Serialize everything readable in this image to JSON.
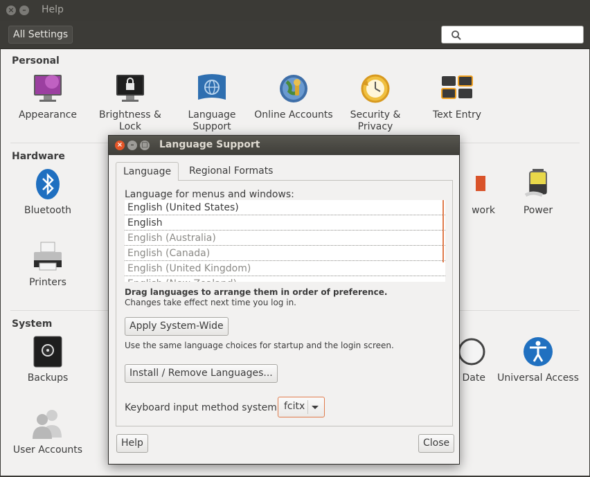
{
  "window": {
    "title": "Help",
    "all_settings_label": "All Settings",
    "close_glyph": "×",
    "minimize_glyph": "–"
  },
  "sections": {
    "personal": {
      "title": "Personal",
      "items": [
        {
          "label": "Appearance",
          "icon": "appearance-icon"
        },
        {
          "label": "Brightness & Lock",
          "icon": "brightness-lock-icon"
        },
        {
          "label": "Language Support",
          "icon": "language-support-icon"
        },
        {
          "label": "Online Accounts",
          "icon": "online-accounts-icon"
        },
        {
          "label": "Security & Privacy",
          "icon": "security-privacy-icon"
        },
        {
          "label": "Text Entry",
          "icon": "text-entry-icon"
        }
      ]
    },
    "hardware": {
      "title": "Hardware",
      "items": [
        {
          "label": "Bluetooth",
          "icon": "bluetooth-icon"
        },
        {
          "label": "Printers",
          "icon": "printer-icon"
        },
        {
          "label": "work",
          "icon": "network-icon"
        },
        {
          "label": "Power",
          "icon": "power-icon"
        }
      ]
    },
    "system": {
      "title": "System",
      "items": [
        {
          "label": "Backups",
          "icon": "backups-icon"
        },
        {
          "label": "User Accounts",
          "icon": "user-accounts-icon"
        },
        {
          "label": "Date",
          "icon": "clock-icon"
        },
        {
          "label": "Universal Access",
          "icon": "universal-access-icon"
        }
      ]
    }
  },
  "dialog": {
    "title": "Language Support",
    "close_glyph": "×",
    "minimize_glyph": "–",
    "maximize_glyph": "□",
    "tabs": [
      {
        "label": "Language",
        "active": true
      },
      {
        "label": "Regional Formats",
        "active": false
      }
    ],
    "language_caption": "Language for menus and windows:",
    "languages": [
      {
        "label": "English (United States)",
        "active": true
      },
      {
        "label": "English",
        "active": true
      },
      {
        "label": "English (Australia)",
        "active": false
      },
      {
        "label": "English (Canada)",
        "active": false
      },
      {
        "label": "English (United Kingdom)",
        "active": false
      },
      {
        "label": "English (New Zealand)",
        "active": false
      }
    ],
    "drag_note": "Drag languages to arrange them in order of preference.",
    "changes_note": "Changes take effect next time you log in.",
    "apply_button": "Apply System-Wide",
    "apply_note": "Use the same language choices for startup and the login screen.",
    "install_button": "Install / Remove Languages...",
    "keyboard_label": "Keyboard input method system:",
    "keyboard_value": "fcitx",
    "help_button": "Help",
    "close_button": "Close"
  },
  "colors": {
    "title_bar": "#3b3a36",
    "content_bg": "#f2f1f0",
    "accent_orange": "#e35527",
    "focus_orange": "#e07a4a"
  }
}
